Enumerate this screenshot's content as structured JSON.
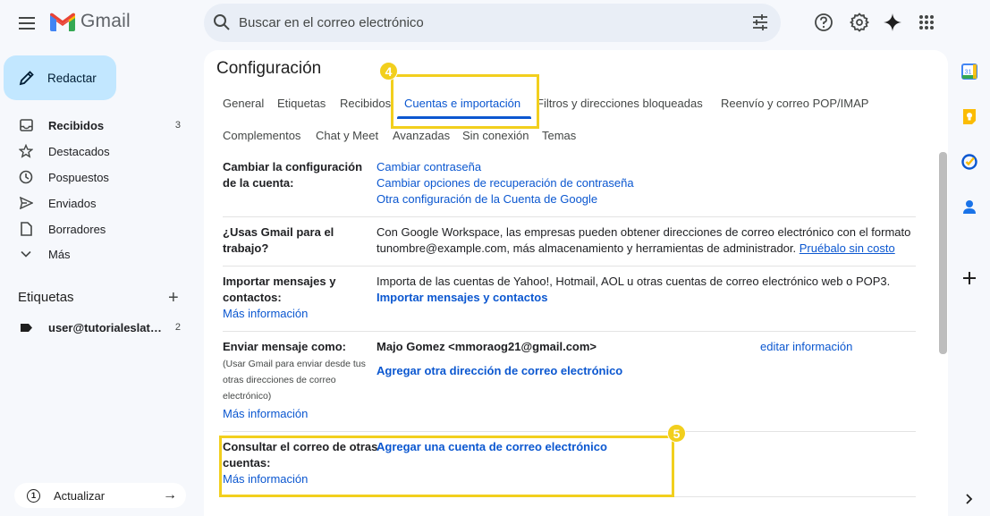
{
  "header": {
    "app_name": "Gmail",
    "search_placeholder": "Buscar en el correo electrónico",
    "icons": [
      "menu-icon",
      "search-icon",
      "filter-options-icon",
      "help-icon",
      "settings-icon",
      "gemini-icon",
      "apps-grid-icon"
    ]
  },
  "sidebar": {
    "compose_label": "Redactar",
    "items": [
      {
        "label": "Recibidos",
        "count": "3",
        "icon": "inbox-icon"
      },
      {
        "label": "Destacados",
        "count": "",
        "icon": "star-icon"
      },
      {
        "label": "Pospuestos",
        "count": "",
        "icon": "clock-icon"
      },
      {
        "label": "Enviados",
        "count": "",
        "icon": "send-icon"
      },
      {
        "label": "Borradores",
        "count": "",
        "icon": "draft-icon"
      },
      {
        "label": "Más",
        "count": "",
        "icon": "chevron-down-icon"
      }
    ],
    "labels_header": "Etiquetas",
    "labels_add": "+",
    "labels": [
      {
        "label": "user@tutorialeslat…",
        "count": "2"
      }
    ],
    "update": {
      "badge": "1",
      "label": "Actualizar",
      "arrow": "→"
    }
  },
  "settings": {
    "title": "Configuración",
    "tabs_row1": [
      "General",
      "Etiquetas",
      "Recibidos",
      "Cuentas e importación",
      "Filtros y direcciones bloqueadas",
      "Reenvío y correo POP/IMAP"
    ],
    "tabs_row2": [
      "Complementos",
      "Chat y Meet",
      "Avanzadas",
      "Sin conexión",
      "Temas"
    ],
    "active_tab": "Cuentas e importación",
    "rows": {
      "account": {
        "label_line1": "Cambiar la configuración",
        "label_line2": "de la cuenta:",
        "links": [
          "Cambiar contraseña",
          "Cambiar opciones de recuperación de contraseña",
          "Otra configuración de la Cuenta de Google"
        ]
      },
      "work": {
        "label_line1": "¿Usas Gmail para el",
        "label_line2": "trabajo?",
        "text_line1": "Con Google Workspace, las empresas pueden obtener direcciones de correo electrónico con el formato",
        "text_line2": "tunombre@example.com, más almacenamiento y herramientas de administrador.",
        "link": "Pruébalo sin costo"
      },
      "import": {
        "label_line1": "Importar mensajes y",
        "label_line2": "contactos:",
        "more": "Más información",
        "text": "Importa de las cuentas de Yahoo!, Hotmail, AOL u otras cuentas de correo electrónico web o POP3.",
        "link": "Importar mensajes y contactos"
      },
      "send_as": {
        "label": "Enviar mensaje como:",
        "note_line1": "(Usar Gmail para enviar desde tus",
        "note_line2": "otras direcciones de correo",
        "note_line3": "electrónico)",
        "more": "Más información",
        "identity": "Majo Gomez <mmoraog21@gmail.com>",
        "edit": "editar información",
        "add": "Agregar otra dirección de correo electrónico"
      },
      "check_mail": {
        "label_line1": "Consultar el correo de otras",
        "label_line2": "cuentas:",
        "more": "Más información",
        "link": "Agregar una cuenta de correo electrónico"
      }
    }
  },
  "annotations": {
    "step4": "4",
    "step5": "5",
    "color": "#f2cf1d"
  },
  "right_apps": [
    "calendar-icon",
    "keep-icon",
    "tasks-icon",
    "contacts-icon",
    "add-addon-icon",
    "expand-panel-icon"
  ]
}
